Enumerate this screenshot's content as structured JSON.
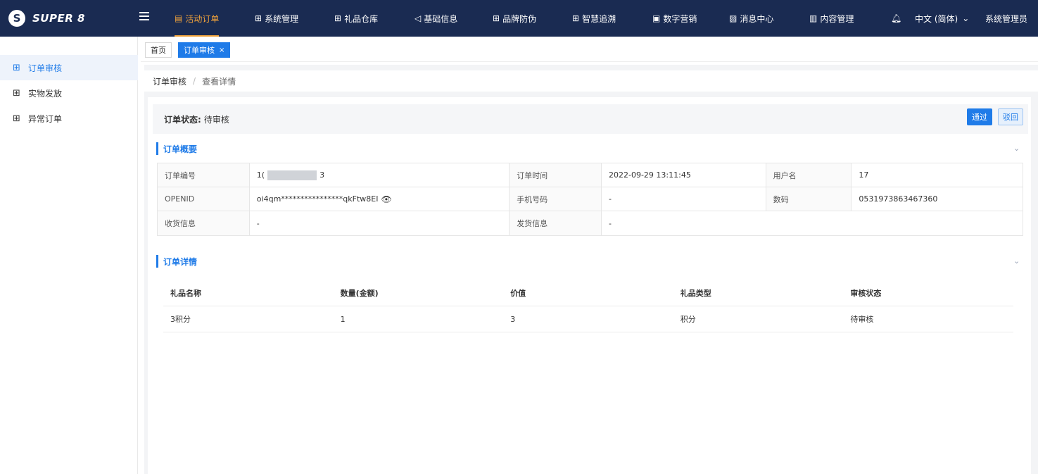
{
  "brand": {
    "name": "SUPER 8",
    "logo_letter": "S"
  },
  "nav": {
    "items": [
      {
        "label": "活动订单",
        "icon": "order-icon",
        "active": true
      },
      {
        "label": "系统管理",
        "icon": "grid-icon"
      },
      {
        "label": "礼品仓库",
        "icon": "grid-icon"
      },
      {
        "label": "基础信息",
        "icon": "speaker-icon"
      },
      {
        "label": "品牌防伪",
        "icon": "grid-icon"
      },
      {
        "label": "智慧追溯",
        "icon": "grid-icon"
      },
      {
        "label": "数字营销",
        "icon": "doc-icon"
      },
      {
        "label": "消息中心",
        "icon": "image-icon"
      },
      {
        "label": "内容管理",
        "icon": "book-icon"
      }
    ],
    "language": "中文 (简体)",
    "user": "系统管理员"
  },
  "sidebar": {
    "items": [
      {
        "label": "订单审核",
        "active": true
      },
      {
        "label": "实物发放"
      },
      {
        "label": "异常订单"
      }
    ]
  },
  "tabs": [
    {
      "label": "首页"
    },
    {
      "label": "订单审核",
      "active": true,
      "close": "×"
    }
  ],
  "breadcrumb": {
    "parent": "订单审核",
    "sep": "/",
    "current": "查看详情"
  },
  "status": {
    "label": "订单状态:",
    "value": "待审核"
  },
  "actions": {
    "pass": "通过",
    "reject": "驳回"
  },
  "overview": {
    "title": "订单概要",
    "order_no_key": "订单编号",
    "order_no_prefix": "1(",
    "order_no_suffix": "3",
    "order_time_key": "订单时间",
    "order_time": "2022-09-29 13:11:45",
    "username_key": "用户名",
    "username": "17",
    "openid_key": "OPENID",
    "openid": "oi4qm****************qkFtw8EI",
    "phone_key": "手机号码",
    "phone": "-",
    "code_key": "数码",
    "code": "0531973863467360",
    "receive_key": "收货信息",
    "receive": "-",
    "ship_key": "发货信息",
    "ship": "-"
  },
  "details": {
    "title": "订单详情",
    "headers": [
      "礼品名称",
      "数量(金额)",
      "价值",
      "礼品类型",
      "审核状态"
    ],
    "rows": [
      [
        "3积分",
        "1",
        "3",
        "积分",
        "待审核"
      ]
    ]
  },
  "colors": {
    "nav_bg": "#1a2b52",
    "accent": "#1f7be8",
    "active_nav": "#f0a23b"
  }
}
